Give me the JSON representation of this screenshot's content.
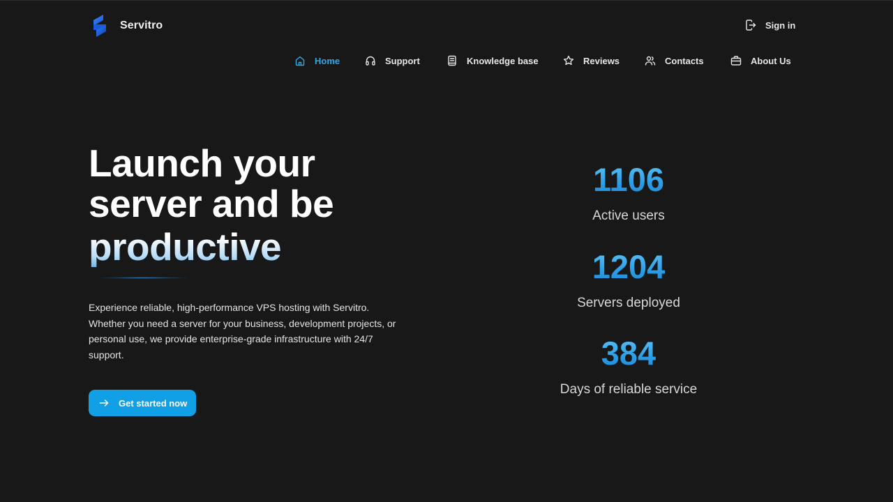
{
  "brand": {
    "name": "Servitro",
    "logo_icon": "servitro-logo-icon",
    "accent_color": "#2ea9ea"
  },
  "header": {
    "signin_label": "Sign in",
    "signin_icon": "sign-in-icon"
  },
  "nav": {
    "items": [
      {
        "label": "Home",
        "icon": "home-icon",
        "active": true
      },
      {
        "label": "Support",
        "icon": "headphones-icon",
        "active": false
      },
      {
        "label": "Knowledge base",
        "icon": "book-icon",
        "active": false
      },
      {
        "label": "Reviews",
        "icon": "star-icon",
        "active": false
      },
      {
        "label": "Contacts",
        "icon": "users-icon",
        "active": false
      },
      {
        "label": "About Us",
        "icon": "briefcase-icon",
        "active": false
      }
    ]
  },
  "hero": {
    "title_lines": [
      "Launch your",
      "server and be",
      "productive"
    ],
    "description": "Experience reliable, high-performance VPS hosting with Servitro. Whether you need a server for your business, development projects, or personal use, we provide enterprise-grade infrastructure with 24/7 support.",
    "cta_label": "Get started now",
    "cta_icon": "arrow-right-icon",
    "cta_color": "#119fe6"
  },
  "stats": [
    {
      "value": "1106",
      "label": "Active users"
    },
    {
      "value": "1204",
      "label": "Servers deployed"
    },
    {
      "value": "384",
      "label": "Days of reliable service"
    }
  ]
}
